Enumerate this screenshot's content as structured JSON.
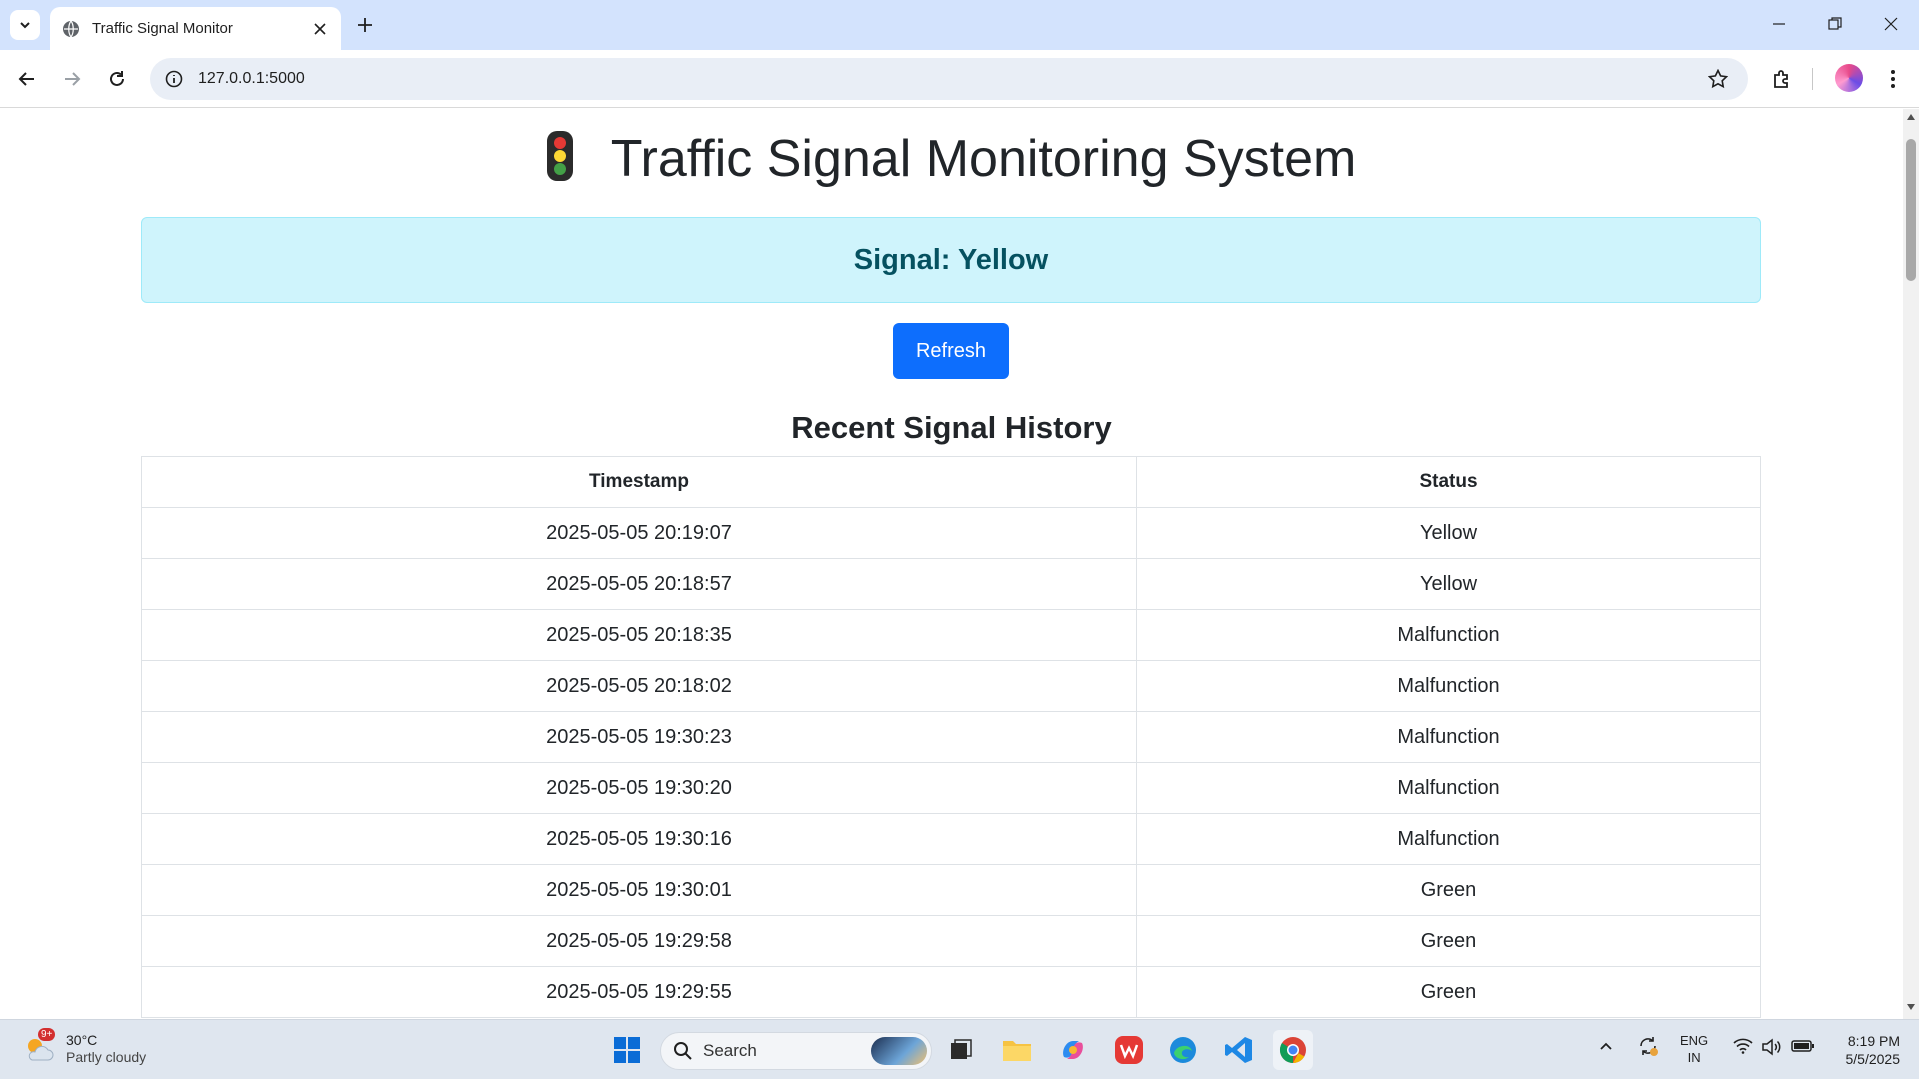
{
  "browser": {
    "tab_title": "Traffic Signal Monitor",
    "url": "127.0.0.1:5000"
  },
  "page": {
    "title": "Traffic Signal Monitoring System",
    "signal_text": "Signal: Yellow",
    "refresh_label": "Refresh",
    "history_heading": "Recent Signal History",
    "columns": [
      "Timestamp",
      "Status"
    ],
    "rows": [
      {
        "timestamp": "2025-05-05 20:19:07",
        "status": "Yellow"
      },
      {
        "timestamp": "2025-05-05 20:18:57",
        "status": "Yellow"
      },
      {
        "timestamp": "2025-05-05 20:18:35",
        "status": "Malfunction"
      },
      {
        "timestamp": "2025-05-05 20:18:02",
        "status": "Malfunction"
      },
      {
        "timestamp": "2025-05-05 19:30:23",
        "status": "Malfunction"
      },
      {
        "timestamp": "2025-05-05 19:30:20",
        "status": "Malfunction"
      },
      {
        "timestamp": "2025-05-05 19:30:16",
        "status": "Malfunction"
      },
      {
        "timestamp": "2025-05-05 19:30:01",
        "status": "Green"
      },
      {
        "timestamp": "2025-05-05 19:29:58",
        "status": "Green"
      },
      {
        "timestamp": "2025-05-05 19:29:55",
        "status": "Green"
      }
    ]
  },
  "taskbar": {
    "weather_badge": "9+",
    "weather_temp": "30°C",
    "weather_desc": "Partly cloudy",
    "search_label": "Search",
    "lang_line1": "ENG",
    "lang_line2": "IN",
    "time": "8:19 PM",
    "date": "5/5/2025"
  },
  "colors": {
    "alert_bg": "#cff4fc",
    "alert_text": "#055160",
    "primary_button": "#0d6efd",
    "tabstrip": "#d3e3fd"
  }
}
